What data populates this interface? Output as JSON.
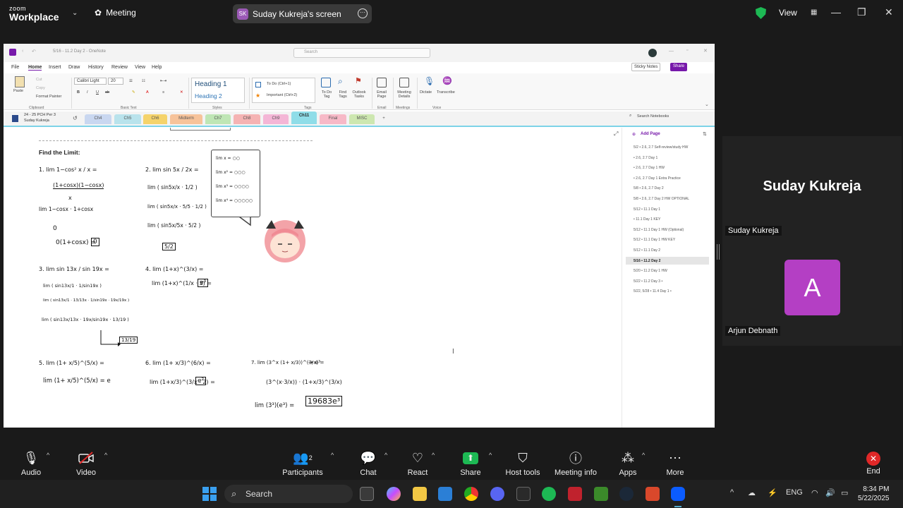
{
  "zoom": {
    "brand_top": "zoom",
    "brand_bottom": "Workplace",
    "meeting_label": "Meeting",
    "share_badge": "SK",
    "share_title": "Suday Kukreja's screen",
    "view_label": "View"
  },
  "onenote": {
    "doc_title": "5/16 - 11.2 Day 2 - OneNote",
    "search_placeholder": "Search",
    "menu": [
      "File",
      "Home",
      "Insert",
      "Draw",
      "History",
      "Review",
      "View",
      "Help"
    ],
    "active_menu": "Home",
    "sticky_notes": "Sticky Notes",
    "share": "Share",
    "ribbon": {
      "paste": "Paste",
      "cut": "Cut",
      "copy": "Copy",
      "format_painter": "Format Painter",
      "clipboard": "Clipboard",
      "font_name": "Calibri Light",
      "font_size": "20",
      "basic_text": "Basic Text",
      "heading1": "Heading 1",
      "heading2": "Heading 2",
      "styles": "Styles",
      "tag1": "To Do (Ctrl+1)",
      "tag2": "Important (Ctrl+2)",
      "tags": "Tags",
      "todo_tag": "To Do Tag",
      "find_tags": "Find Tags",
      "outlook_tasks": "Outlook Tasks",
      "email_page": "Email Page",
      "email": "Email",
      "meeting_details": "Meeting Details",
      "meetings": "Meetings",
      "dictate": "Dictate",
      "transcribe": "Transcribe",
      "voice": "Voice"
    },
    "notebook": "24 - 25 PCH Per 3",
    "notebook_owner": "Suday Kukreja",
    "tabs": [
      {
        "label": "Ch4",
        "color": "#c9d7f0"
      },
      {
        "label": "Ch5",
        "color": "#b9e3ec"
      },
      {
        "label": "Ch6",
        "color": "#f5d36b"
      },
      {
        "label": "Midterm",
        "color": "#f7c39a"
      },
      {
        "label": "Ch7",
        "color": "#bfe6b5"
      },
      {
        "label": "Ch8",
        "color": "#f5b3b3"
      },
      {
        "label": "Ch9",
        "color": "#f4b6d6"
      },
      {
        "label": "Ch11",
        "color": "#8fdde8"
      },
      {
        "label": "Final",
        "color": "#f7b9c7"
      },
      {
        "label": "MISC",
        "color": "#cde7b0"
      },
      {
        "label": "+",
        "color": "#f3f3f3"
      }
    ],
    "search_notebooks": "Search Notebooks",
    "add_page": "Add Page",
    "pages": [
      "5/2 • 2.6, 2.7 Self-review/study HW",
      "• 2.6, 2.7 Day 1",
      "• 2.6, 2.7 Day 1 HW",
      "• 2.6, 2.7 Day 1 Extra Practice",
      "5/8 • 2.6, 2.7 Day 2",
      "5/8 • 2.6, 2.7 Day 2 HW OPTIONAL",
      "5/12 • 11.1 Day 1",
      "• 11.1 Day 1 KEY",
      "5/12 • 11.1 Day 1 HW (Optional)",
      "5/12 • 11.1 Day 1 HW KEY",
      "5/12 • 11.1 Day 2",
      "5/16 • 11.2 Day 2",
      "5/20 • 11.2 Day 1 HW",
      "5/22 • 11.2 Day 3  •",
      "5/22, 5/28 • 11.4 Day 1  •"
    ],
    "selected_page": 11
  },
  "notes": {
    "heading": "Find the Limit:",
    "p1": "1. lim  1−cos² x / x  =",
    "p1a": "(1+cosx)(1−cosx)",
    "p1b": "x",
    "p1c": "lim  1−cosx · 1+cosx",
    "p1d": "0",
    "p1e": "0(1+cosx) =",
    "p1ans": "0",
    "p2": "2. lim  sin 5x / 2x  =",
    "p2a": "lim ( sin5x/x · 1/2 )",
    "p2b": "lim ( sin5x/x · 5/5 · 1/2 )",
    "p2c": "lim ( sin5x/5x · 5/2 )",
    "p2ans": "5/2",
    "p3": "3. lim  sin 13x / sin 19x  =",
    "p3a": "lim ( sin13x/1 · 1/sin19x )",
    "p3b": "lim ( sin13x/1 · 13/13x · 1/sin19x · 19x/19x )",
    "p3c": "lim ( sin13x/13x · 19x/sin19x · 13/19 )",
    "p3ans": "13/19",
    "p4": "4. lim (1+x)^(3/x) =",
    "p4a": "lim (1+x)^(1/x · 3) =",
    "p4ans": "e³",
    "p5": "5. lim (1+ x/5)^(5/x) =",
    "p5a": "lim (1+ x/5)^(5/x) = e",
    "p6": "6. lim (1+ x/3)^(6/x) =",
    "p6a": "lim (1+x/3)^(3/x · 2) =",
    "p6ans": "e²",
    "p7": "7. lim (3^x (1+ x/3))^(3/x) =",
    "p7arrow": "→ e³",
    "p7a": "(3^(x·3/x)) · (1+x/3)^(3/x)",
    "p7b": "lim (3³)(e³) =",
    "p7ans": "19683e³",
    "bubble": [
      "lim x = ○○",
      "lim x² = ○○○",
      "lim x³ = ○○○○",
      "lim x⁴ = ○○○○○"
    ]
  },
  "participants": {
    "presenter_big": "Suday Kukreja",
    "presenter_label": "Suday Kukreja",
    "other_initial": "A",
    "other_label": "Arjun Debnath"
  },
  "toolbar": {
    "audio": "Audio",
    "video": "Video",
    "participants": "Participants",
    "participants_count": "2",
    "chat": "Chat",
    "react": "React",
    "share": "Share",
    "host_tools": "Host tools",
    "meeting_info": "Meeting info",
    "apps": "Apps",
    "more": "More",
    "end": "End"
  },
  "taskbar": {
    "search": "Search",
    "lang": "ENG",
    "time": "8:34 PM",
    "date": "5/22/2025"
  },
  "colors": {
    "onenote_purple": "#7719aa",
    "zoom_share_green": "#1db954",
    "end_red": "#e02828",
    "avatar_purple": "#b43fc4"
  }
}
